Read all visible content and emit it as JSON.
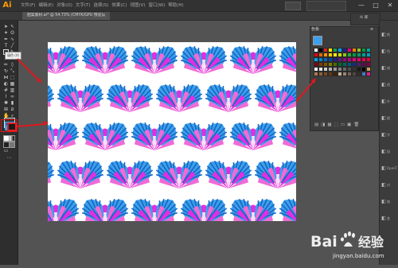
{
  "menu": {
    "app_logo": "Ai",
    "items": [
      "文件(F)",
      "编辑(E)",
      "对象(O)",
      "文字(T)",
      "选择(S)",
      "效果(C)",
      "视图(V)",
      "窗口(W)",
      "帮助(H)"
    ],
    "window_controls": [
      "—",
      "□",
      "✕"
    ]
  },
  "document_tab": {
    "label": "图案素材.ai* @ 54.73% (CMYK/GPU 预览)",
    "close": "✕"
  },
  "tools": {
    "tooltip": "填色 (X)"
  },
  "swatch_panel": {
    "title": "色板",
    "menu_icon": "≡",
    "swatches": [
      "#ffffff",
      "#000000",
      "#e02020",
      "#ffe600",
      "#12a14a",
      "#00a0e9",
      "#1d2088",
      "#e4007f",
      "#f08300",
      "#8fc31f",
      "#009944",
      "#00a7a0",
      "#e60012",
      "#eb6100",
      "#f39800",
      "#fcc800",
      "#fff100",
      "#cfdb00",
      "#8fc31f",
      "#22ac38",
      "#009944",
      "#009b6b",
      "#009e96",
      "#00a0c1",
      "#00a0e9",
      "#0086d1",
      "#0068b7",
      "#00479d",
      "#1d2088",
      "#601986",
      "#920783",
      "#be0081",
      "#e4007f",
      "#e5006a",
      "#e5004f",
      "#e60033",
      "#7f0019",
      "#7f3b00",
      "#7f5700",
      "#7f7700",
      "#4a6b00",
      "#006934",
      "#00645e",
      "#005588",
      "#172a88",
      "#4e1d6e",
      "#6a005f",
      "#7f0045",
      "#ffffff",
      "#e6e6e6",
      "#cccccc",
      "#b3b3b3",
      "#999999",
      "#808080",
      "#666666",
      "#4d4d4d",
      "#333333",
      "#1a1a1a",
      "#000000",
      "#c9a063",
      "#a67c52",
      "#8c6239",
      "#754c24",
      "#603813",
      "#42210b",
      "#c7b299",
      "#998675",
      "#736357",
      "#534741",
      "#362f2d",
      "#3f7fbf",
      "#e21d8e"
    ],
    "bottom_icons": [
      "▤",
      "◨",
      "▦",
      "⬚",
      "▭",
      "▣",
      "🗑"
    ]
  },
  "right_dock": {
    "labels": [
      "颜",
      "色",
      "描",
      "透",
      "外",
      "图",
      "字",
      "段",
      "OpenT",
      "对",
      "路",
      "变"
    ],
    "panel2_label": "Ai 库"
  },
  "pattern": {
    "colors": {
      "background": "#ffffff",
      "blue_light": "#3da0e8",
      "blue_dark": "#1565c8",
      "magenta": "#e02fe0",
      "pink": "#f06ad8"
    }
  },
  "watermark": {
    "text": "Bai",
    "text2": "经验",
    "url": "jingyan.baidu.com"
  }
}
